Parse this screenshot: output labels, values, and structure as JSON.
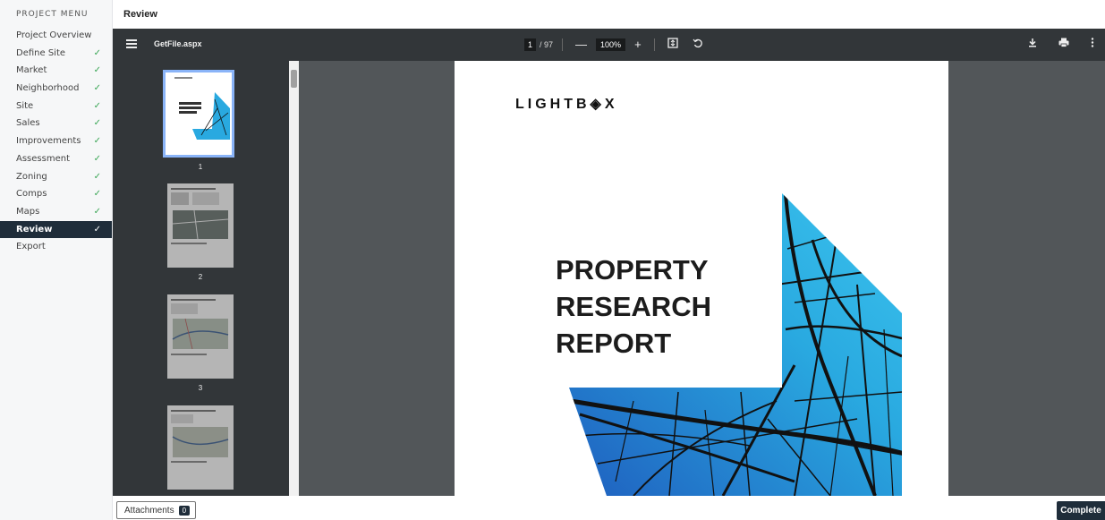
{
  "sidebar": {
    "header": "PROJECT MENU",
    "items": [
      {
        "label": "Project Overview",
        "check": ""
      },
      {
        "label": "Define Site",
        "check": "✓"
      },
      {
        "label": "Market",
        "check": "✓"
      },
      {
        "label": "Neighborhood",
        "check": "✓"
      },
      {
        "label": "Site",
        "check": "✓"
      },
      {
        "label": "Sales",
        "check": "✓"
      },
      {
        "label": "Improvements",
        "check": "✓"
      },
      {
        "label": "Assessment",
        "check": "✓"
      },
      {
        "label": "Zoning",
        "check": "✓"
      },
      {
        "label": "Comps",
        "check": "✓"
      },
      {
        "label": "Maps",
        "check": "✓"
      },
      {
        "label": "Review",
        "check": "✓"
      },
      {
        "label": "Export",
        "check": ""
      }
    ]
  },
  "page_title": "Review",
  "viewer": {
    "filename": "GetFile.aspx",
    "current_page": "1",
    "total_pages": "/ 97",
    "zoom": "100%",
    "zoom_out_label": "—",
    "zoom_in_label": "+",
    "icons": {
      "menu": "menu-icon",
      "fit": "fit-page-icon",
      "rotate": "rotate-icon",
      "download": "download-icon",
      "print": "print-icon",
      "more": "more-vert-icon"
    },
    "thumbnails": [
      {
        "num": "1"
      },
      {
        "num": "2"
      },
      {
        "num": "3"
      },
      {
        "num": ""
      }
    ],
    "document": {
      "logo": "LIGHTB◈X",
      "title_lines": [
        "PROPERTY",
        "RESEARCH",
        "REPORT"
      ]
    }
  },
  "footer": {
    "attachments_label": "Attachments",
    "attachments_count": "0",
    "complete_label": "Complete"
  },
  "colors": {
    "sidebar_active": "#1f2d3a",
    "check_green": "#3aa655",
    "viewer_bg": "#525659",
    "toolbar_bg": "#323639",
    "map_blue": "#29a9e0"
  }
}
